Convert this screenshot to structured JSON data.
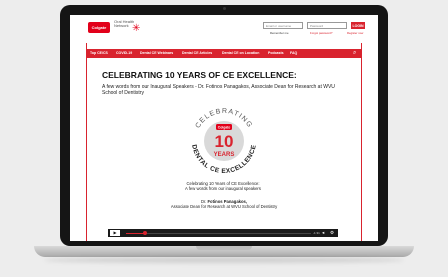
{
  "header": {
    "logo_text": "Colgate",
    "brand_text": "Oral Health Network",
    "email_placeholder": "Email or username",
    "password_placeholder": "Password",
    "login_label": "LOGIN",
    "remember_label": "Remember me",
    "forgot_label": "Forgot password?",
    "register_label": "Register now"
  },
  "nav": {
    "items": [
      {
        "label": "Top CE/CS"
      },
      {
        "label": "COVID-19"
      },
      {
        "label": "Dental CE Webinars"
      },
      {
        "label": "Dental CE Articles"
      },
      {
        "label": "Dental CE on Location"
      },
      {
        "label": "Podcasts"
      },
      {
        "label": "FAQ"
      }
    ]
  },
  "main": {
    "title": "CELEBRATING 10 YEARS OF CE EXCELLENCE:",
    "subtitle": "A few words from our Inaugural Speakers - Dr. Fotinos Panagakos, Associate Dean for Research at WVU School of Dentistry"
  },
  "badge": {
    "top_text": "CELEBRATING",
    "bottom_text": "DENTAL CE EXCELLENCE",
    "logo_text": "Colgate",
    "number": "10",
    "years_label": "YEARS"
  },
  "captions": {
    "line1": "Celebrating 10 Years of CE Excellence:",
    "line2": "A few words from our inaugural speakers",
    "speaker_prefix": "Dr. ",
    "speaker_name": "Fotinos Panagakos,",
    "speaker_role": "Associate Dean for Research at WVU School of Dentistry"
  },
  "player": {
    "progress": 0.1,
    "time_text": "-1:31"
  },
  "colors": {
    "brand_red": "#d9232e",
    "player_bg": "#1a1a1a"
  }
}
